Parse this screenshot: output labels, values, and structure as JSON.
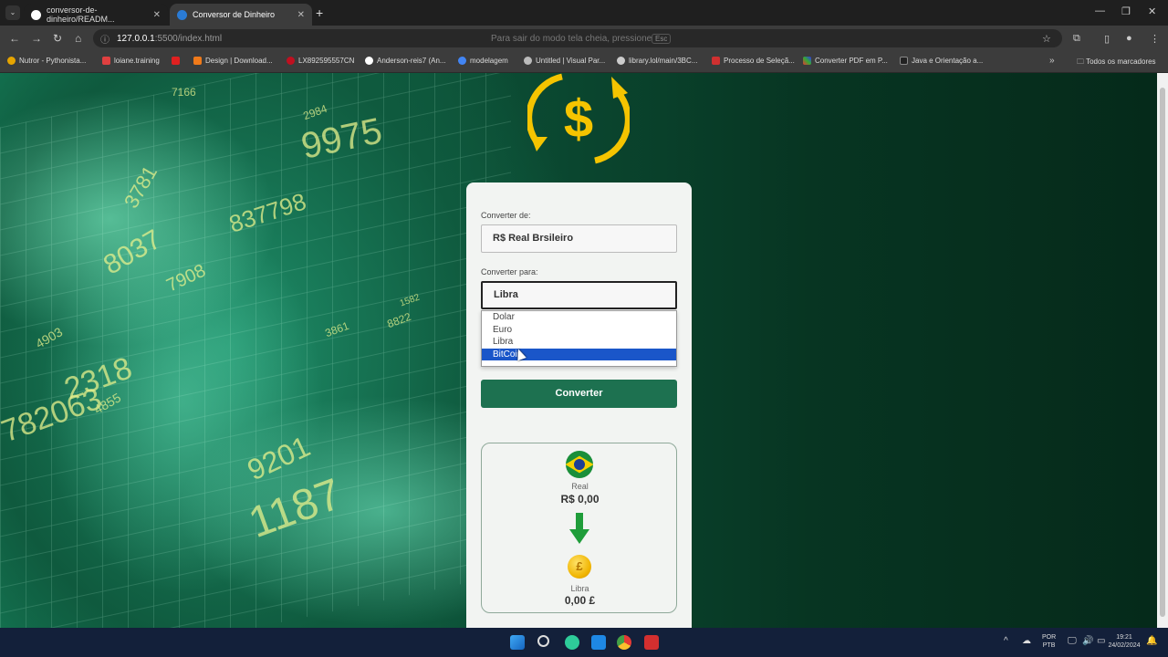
{
  "browser": {
    "tabs": [
      {
        "title": "conversor-de-dinheiro/READM..."
      },
      {
        "title": "Conversor de Dinheiro"
      }
    ],
    "url": {
      "host": "127.0.0.1",
      "path": ":5500/index.html"
    },
    "fullscreen_hint": "Para sair do modo tela cheia, pressione",
    "esc_key": "Esc",
    "bookmarks": [
      {
        "label": "Nutror - Pythonista..."
      },
      {
        "label": "loiane.training"
      },
      {
        "label": ""
      },
      {
        "label": "Design | Download..."
      },
      {
        "label": "LX892595557CN"
      },
      {
        "label": "Anderson-reis7 (An..."
      },
      {
        "label": "modelagem"
      },
      {
        "label": "Untitled | Visual Par..."
      },
      {
        "label": "library.lol/main/3BC..."
      },
      {
        "label": "Processo de Seleçã..."
      },
      {
        "label": "Converter PDF em P..."
      },
      {
        "label": "Java e Orientação a..."
      }
    ],
    "all_bookmarks": "Todos os marcadores"
  },
  "background_numbers": [
    "9975",
    "7166",
    "2984",
    "837798",
    "3781",
    "8037",
    "7908",
    "4903",
    "2318",
    "782063",
    "4855",
    "9201",
    "1187",
    "1582",
    "3861",
    "8822"
  ],
  "converter": {
    "from_label": "Converter de:",
    "from_value": "R$ Real Brsileiro",
    "to_label": "Converter para:",
    "to_value": "Libra",
    "options": [
      "Dolar",
      "Euro",
      "Libra",
      "BitCoin"
    ],
    "selected_option_index": 3,
    "button_label": "Converter",
    "from_currency_name": "Real",
    "from_currency_value": "R$ 0,00",
    "to_currency_name": "Libra",
    "to_currency_value": "0,00 £",
    "coin_symbol": "£",
    "accent_color": "#1d7150",
    "logo_color": "#f5c400"
  },
  "taskbar": {
    "lang_top": "POR",
    "lang_bottom": "PTB",
    "time": "19:21",
    "date": "24/02/2024"
  }
}
